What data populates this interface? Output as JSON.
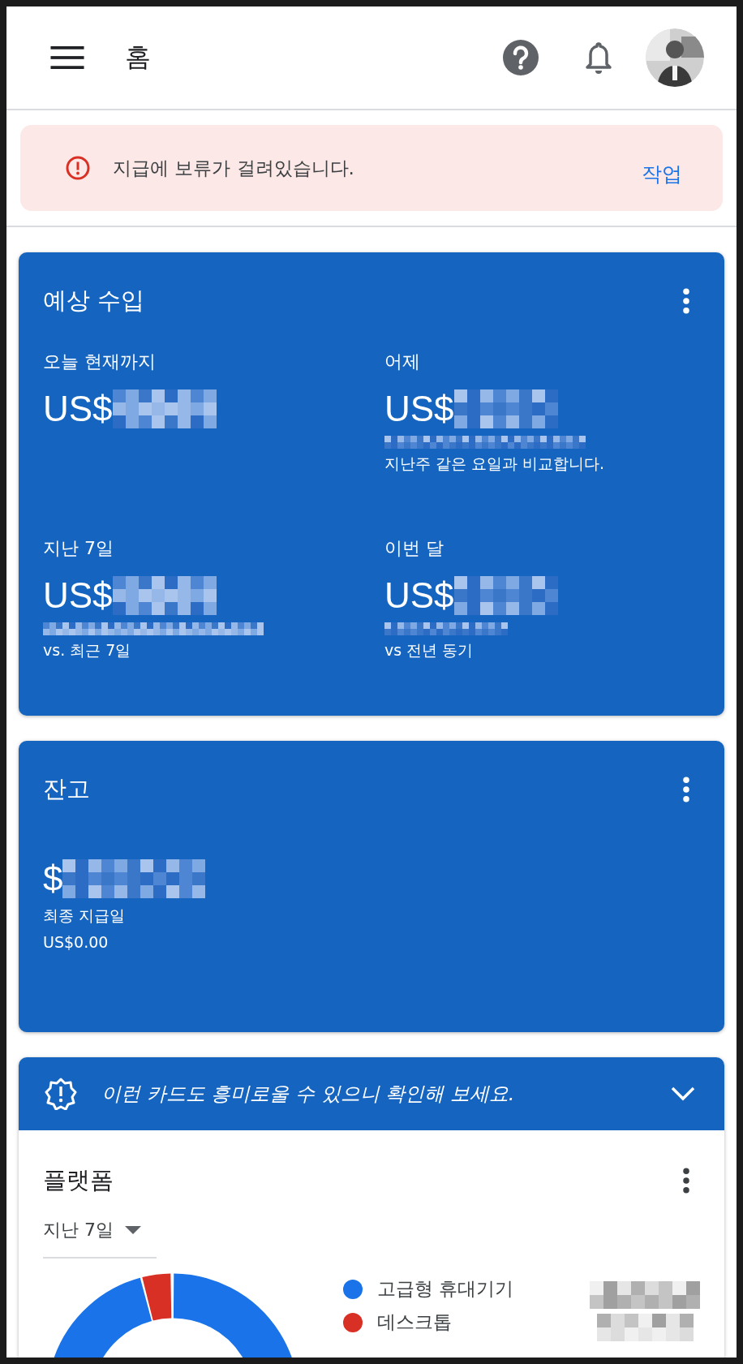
{
  "app_bar": {
    "title": "홈"
  },
  "alert": {
    "message": "지급에 보류가 걸려있습니다.",
    "action": "작업"
  },
  "estimated_earnings": {
    "title": "예상 수입",
    "metrics": [
      {
        "label": "오늘 현재까지",
        "prefix": "US$"
      },
      {
        "label": "어제",
        "prefix": "US$",
        "comparison": "지난주 같은 요일과 비교합니다."
      },
      {
        "label": "지난 7일",
        "prefix": "US$",
        "comparison": "vs. 최근 7일"
      },
      {
        "label": "이번 달",
        "prefix": "US$",
        "comparison": "vs 전년 동기"
      }
    ]
  },
  "balance": {
    "title": "잔고",
    "prefix": "$",
    "last_payment_label": "최종 지급일",
    "last_payment_amount": "US$0.00"
  },
  "suggestion": {
    "message": "이런 카드도 흥미로울 수 있으니 확인해 보세요."
  },
  "platform": {
    "title": "플랫폼",
    "range": "지난 7일",
    "legend": [
      {
        "label": "고급형 휴대기기",
        "color": "#1a73e8"
      },
      {
        "label": "데스크톱",
        "color": "#d93025"
      }
    ]
  }
}
